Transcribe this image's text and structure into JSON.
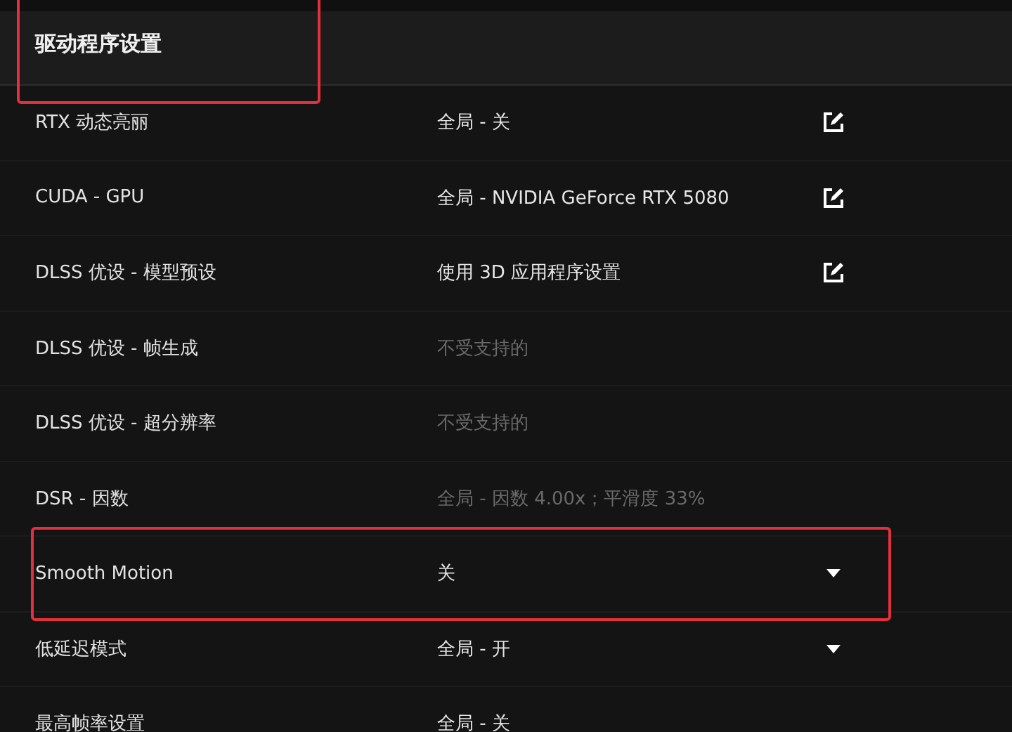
{
  "header": {
    "title": "驱动程序设置",
    "highlighted": true
  },
  "rows": [
    {
      "label": "RTX 动态亮丽",
      "value": "全局 - 关",
      "disabled": false,
      "kind": "edit",
      "highlighted": false
    },
    {
      "label": "CUDA - GPU",
      "value": "全局 - NVIDIA GeForce RTX 5080",
      "disabled": false,
      "kind": "edit",
      "highlighted": false
    },
    {
      "label": "DLSS 优设 - 模型预设",
      "value": "使用 3D 应用程序设置",
      "disabled": false,
      "kind": "edit",
      "highlighted": false
    },
    {
      "label": "DLSS 优设 - 帧生成",
      "value": "不受支持的",
      "disabled": true,
      "kind": "none",
      "highlighted": false
    },
    {
      "label": "DLSS 优设 - 超分辨率",
      "value": "不受支持的",
      "disabled": true,
      "kind": "none",
      "highlighted": false
    },
    {
      "label": "DSR - 因数",
      "value": "全局 - 因数 4.00x；平滑度 33%",
      "disabled": true,
      "kind": "none",
      "highlighted": false
    },
    {
      "label": "Smooth Motion",
      "value": "关",
      "disabled": false,
      "kind": "dropdown",
      "highlighted": true
    },
    {
      "label": "低延迟模式",
      "value": "全局 - 开",
      "disabled": false,
      "kind": "dropdown",
      "highlighted": false
    },
    {
      "label": "最高帧率设置",
      "value": "全局 - 关",
      "disabled": false,
      "kind": "none",
      "highlighted": false
    }
  ]
}
